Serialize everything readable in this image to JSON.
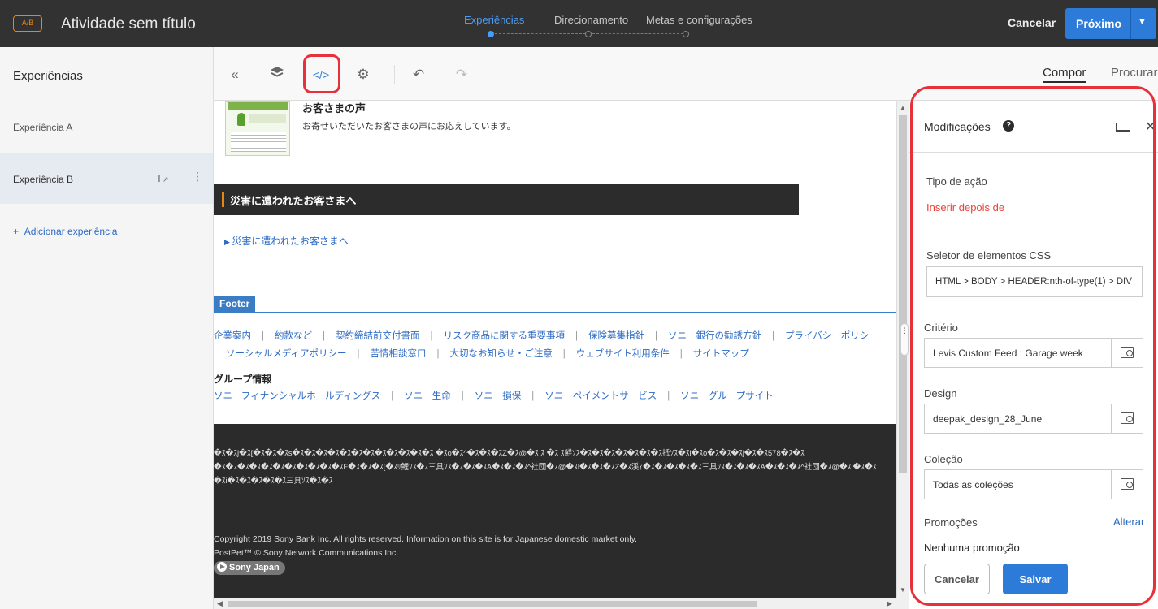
{
  "header": {
    "badge": "A/B",
    "title": "Atividade sem título",
    "steps": [
      "Experiências",
      "Direcionamento",
      "Metas e configurações"
    ],
    "active_step": 0,
    "cancel_label": "Cancelar",
    "next_label": "Próximo",
    "accent": "#2d7bd8"
  },
  "sidebar": {
    "title": "Experiências",
    "experiences": [
      {
        "label": "Experiência A"
      },
      {
        "label": "Experiência B"
      }
    ],
    "add_label": "Adicionar experiência"
  },
  "toolbar": {
    "icons": [
      "collapse-icon",
      "layers-icon",
      "code-icon",
      "gear-icon",
      "undo-icon",
      "redo-icon"
    ],
    "highlighted_icon": "code-icon",
    "tabs": [
      "Compor",
      "Procurar"
    ],
    "active_tab": "Compor"
  },
  "canvas": {
    "voice_title": "お客さまの声",
    "voice_subtitle": "お寄せいただいたお客さまの声にお応えしています。",
    "disaster_heading": "災害に遭われたお客さまへ",
    "disaster_link": "災害に遭われたお客さまへ",
    "footer_tab": "Footer",
    "links_row1": [
      "企業案内",
      "約款など",
      "契約締結前交付書面",
      "リスク商品に関する重要事項",
      "保険募集指針",
      "ソニー銀行の勧誘方針",
      "プライバシーポリシ"
    ],
    "links_row2": [
      "ソーシャルメディアポリシー",
      "苦情相談窓口",
      "大切なお知らせ・ご注意",
      "ウェブサイト利用条件",
      "サイトマップ"
    ],
    "group_title": "グループ情報",
    "group_links": [
      "ソニーフィナンシャルホールディングス",
      "ソニー生命",
      "ソニー損保",
      "ソニーペイメントサービス",
      "ソニーグループサイト"
    ],
    "garbled_lines": [
      "�ｽ�ｽj�ｽ[�ｽ�ｽ�ｽs�ｽ�ｽ�ｽ�ｽ�ｽ�ｽ�ｽ�ｽ�ｽ�ｽ�ｽ�ｽ   �ｽo�ｽ^�ｽ�ｽ�ｽZ�ｽ@�ｽ ｽ   �ｽ ｽ鮮ｿｽ�ｽ�ｽ�ｽ�ｽ�ｽ�ｽ�ｽ抵ｿｽ�ｽi�ｽo�ｽ�ｽ�ｽj�ｽ�ｽ578�ｽ�ｽ",
      "�ｽ�ｽ�ｽ�ｽ�ｽ�ｽ�ｽ�ｽ�ｽ�ｽ�ｽF�ｽ�ｽ�ｽ[�ｽﾘ鯉ｿｽ�ｽ三具ｿｽ�ｽ�ｽ�ｽA�ｽ�ｽ�ｽ^社団�ｽ@�ｽl�ｽ�ｽ�ｽZ�ｽ渓ｨ�ｽ�ｽ�ｽ�ｽ�ｽ三具ｿｽ�ｽ�ｽ�ｽA�ｽ�ｽ�ｽ^社団�ｽ@�ｽl�ｽ�ｽ",
      "�ｽi�ｽ�ｽ�ｽ�ｽ�ｽ三具ｿｽ�ｽ�ｽ"
    ],
    "copyright": "Copyright 2019 Sony Bank Inc. All rights reserved. Information on this site is for Japanese domestic market only.",
    "postpet": "PostPet™ © Sony Network Communications Inc.",
    "sony_japan": "Sony Japan"
  },
  "panel": {
    "title": "Modificações",
    "action_type_label": "Tipo de ação",
    "action_type_value": "Inserir depois de",
    "css_selector_label": "Seletor de elementos CSS",
    "css_selector_value": "HTML > BODY > HEADER:nth-of-type(1) > DIV",
    "criteria_label": "Critério",
    "criteria_value": "Levis Custom Feed : Garage week",
    "design_label": "Design",
    "design_value": "deepak_design_28_June",
    "collection_label": "Coleção",
    "collection_value": "Todas as coleções",
    "promotions_label": "Promoções",
    "alterar_label": "Alterar",
    "no_promotion": "Nenhuma promoção",
    "cancel_label": "Cancelar",
    "save_label": "Salvar",
    "action_color": "#e8443a"
  }
}
